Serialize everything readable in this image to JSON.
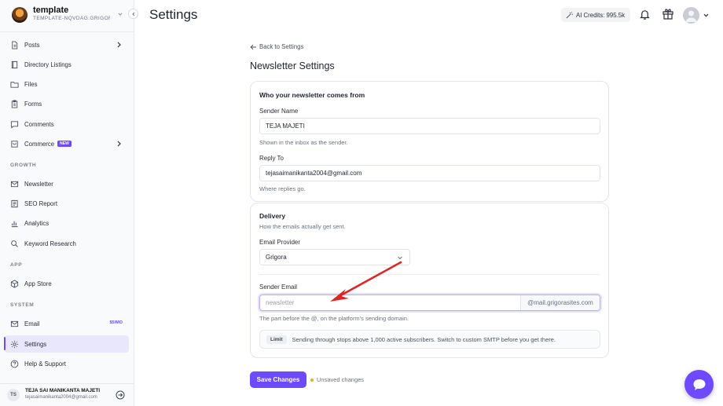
{
  "workspace": {
    "name": "template",
    "subdomain": "TEMPLATE-NQVDAG.GRIGOR..."
  },
  "sidebar": {
    "items": [
      {
        "label": "Posts"
      },
      {
        "label": "Directory Listings"
      },
      {
        "label": "Files"
      },
      {
        "label": "Forms"
      },
      {
        "label": "Comments"
      },
      {
        "label": "Commerce",
        "badge": "NEW"
      },
      {
        "label": "Newsletter"
      },
      {
        "label": "SEO Report"
      },
      {
        "label": "Analytics"
      },
      {
        "label": "Keyword Research"
      },
      {
        "label": "App Store"
      },
      {
        "label": "Email",
        "badge": "$5/MO"
      },
      {
        "label": "Settings"
      },
      {
        "label": "Help & Support"
      }
    ],
    "sections": {
      "growth": "GROWTH",
      "app": "APP",
      "system": "SYSTEM"
    },
    "active_item": "Settings",
    "user": {
      "initials": "TS",
      "name": "TEJA SAI MANIKANTA MAJETI",
      "email": "tejasaimanikanta2004@gmail.com"
    }
  },
  "header": {
    "title": "Settings",
    "ai_credits": "AI Credits: 995.5k"
  },
  "main": {
    "back_link": "Back to Settings",
    "heading": "Newsletter Settings",
    "from_card": {
      "title": "Who your newsletter comes from",
      "sender_name_label": "Sender Name",
      "sender_name_value": "TEJA MAJETI",
      "sender_name_help": "Shown in the inbox as the sender.",
      "reply_to_label": "Reply To",
      "reply_to_value": "tejasaimanikanta2004@gmail.com",
      "reply_to_help": "Where replies go."
    },
    "delivery_card": {
      "title": "Delivery",
      "subtitle": "How the emails actually get sent.",
      "provider_label": "Email Provider",
      "provider_value": "Grigora",
      "sender_email_label": "Sender Email",
      "sender_email_placeholder": "newsletter",
      "sender_email_suffix": "@mail.grigorasites.com",
      "sender_email_help": "The part before the @, on the platform's sending domain.",
      "limit_tag": "Limit",
      "limit_text": "Sending through stops above 1,000 active subscribers. Switch to custom SMTP before you get there."
    },
    "save_label": "Save Changes",
    "unsaved_label": "Unsaved changes"
  },
  "colors": {
    "accent": "#6d4aff",
    "annotation_arrow": "#e02424",
    "unsaved_dot": "#e8b020"
  },
  "icons": {
    "posts": "document-icon",
    "directory": "book-icon",
    "files": "folder-icon",
    "forms": "clipboard-icon",
    "comments": "chat-bubble-icon",
    "commerce": "cart-icon",
    "newsletter": "mail-icon",
    "seo": "report-icon",
    "analytics": "bar-chart-icon",
    "keyword": "search-icon",
    "app_store": "cube-icon",
    "email": "mail-icon",
    "settings": "gear-icon",
    "help": "help-circle-icon"
  }
}
